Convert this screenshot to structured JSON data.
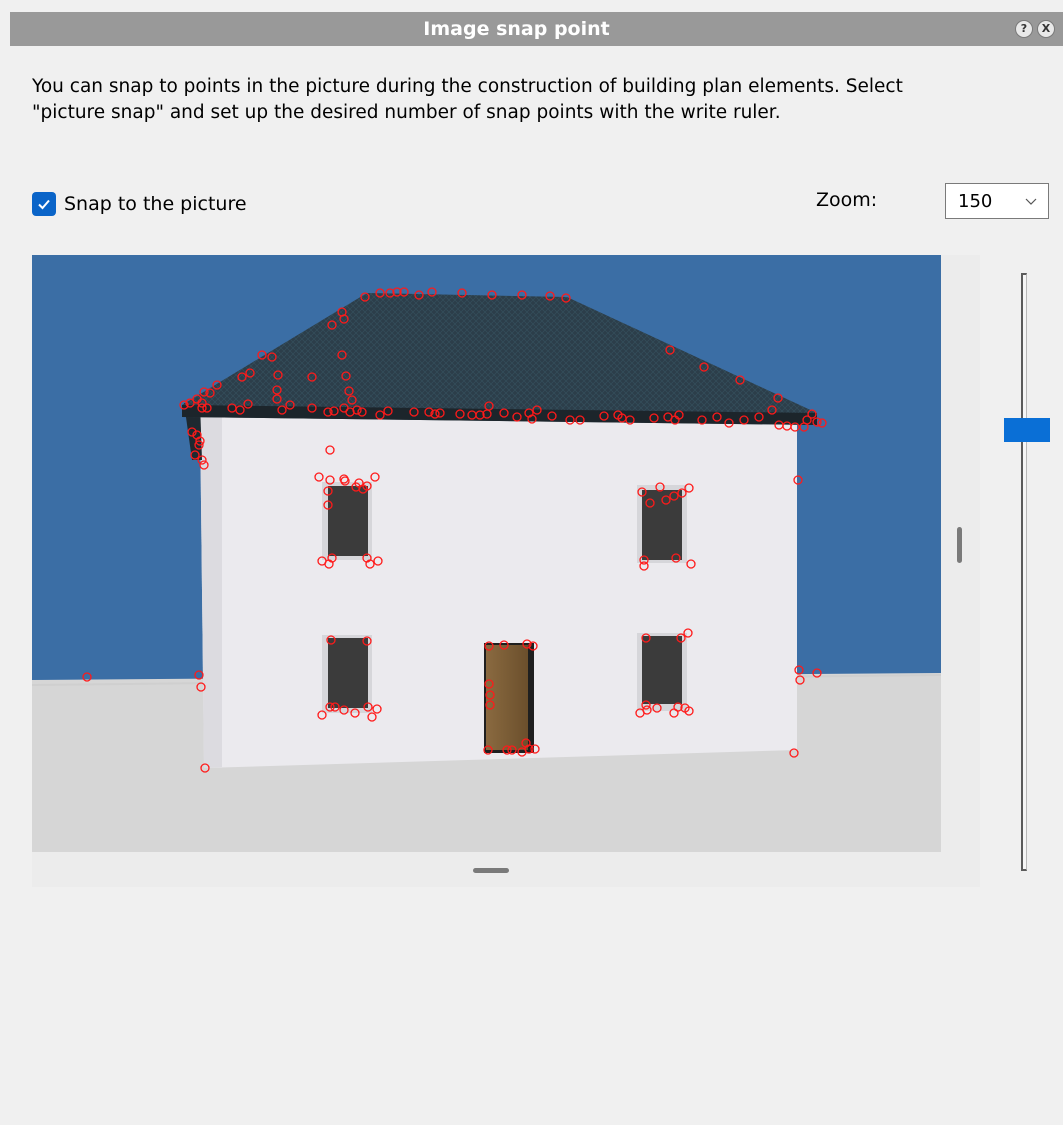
{
  "window": {
    "title": "Image snap point",
    "help_glyph": "?",
    "close_glyph": "X"
  },
  "intro_text": "You can snap to points in the picture during the construction of building plan elements. Select\n\"picture snap\" and set up the desired number of snap points with the write ruler.",
  "snap": {
    "label": "Snap to the picture",
    "checked": true
  },
  "zoom": {
    "label": "Zoom:",
    "value": "150"
  },
  "slider": {
    "level": 0.25
  },
  "colors": {
    "accent": "#0a64c8",
    "snap_point": "#ff1a1a",
    "sky": "#3a6ea5",
    "roof": "#2b3d48",
    "wall": "#ecebef"
  },
  "icons": {
    "help": "help-icon",
    "close": "close-icon",
    "check": "checkmark-icon",
    "dropdown": "chevron-down-icon"
  }
}
